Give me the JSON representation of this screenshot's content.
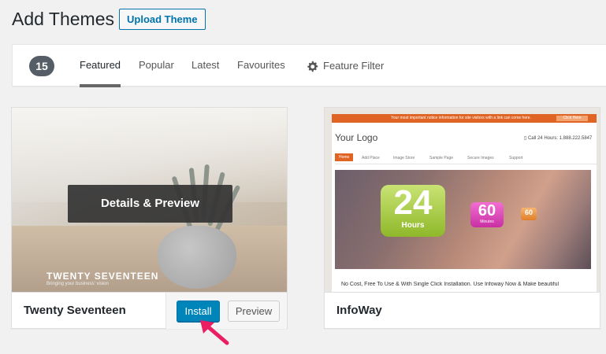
{
  "header": {
    "title": "Add Themes",
    "upload_label": "Upload Theme"
  },
  "filter_bar": {
    "count": "15",
    "tabs": [
      "Featured",
      "Popular",
      "Latest",
      "Favourites"
    ],
    "active_tab": "Featured",
    "feature_filter_label": "Feature Filter",
    "feature_filter_icon": "gear-icon"
  },
  "themes": [
    {
      "name": "Twenty Seventeen",
      "overlay_label": "Details & Preview",
      "screenshot_brand": "TWENTY SEVENTEEN",
      "screenshot_tagline": "Bringing your business' vision",
      "install_label": "Install",
      "preview_label": "Preview"
    },
    {
      "name": "InfoWay",
      "screenshot": {
        "topbar_text": "Your most important notice information for site visitors with a link can come here.",
        "topbar_button": "Click Here",
        "logo": "Your Logo",
        "phone": "Call 24 Hours: 1.888.222.5847",
        "nav": [
          "Home",
          "Add Place",
          "Image Store",
          "Sample Page",
          "Secure Images",
          "Support"
        ],
        "badge_24": "24",
        "badge_24_sub": "Hours",
        "badge_60": "60",
        "badge_60_sub": "Minutes",
        "badge_60s": "60",
        "caption": "No Cost, Free To Use & With Single Click Installation. Use Infoway Now & Make beautiful"
      }
    }
  ],
  "colors": {
    "accent": "#0085ba",
    "badge": "#555d66",
    "infoway_orange": "#e06423",
    "arrow": "#e91e63"
  }
}
